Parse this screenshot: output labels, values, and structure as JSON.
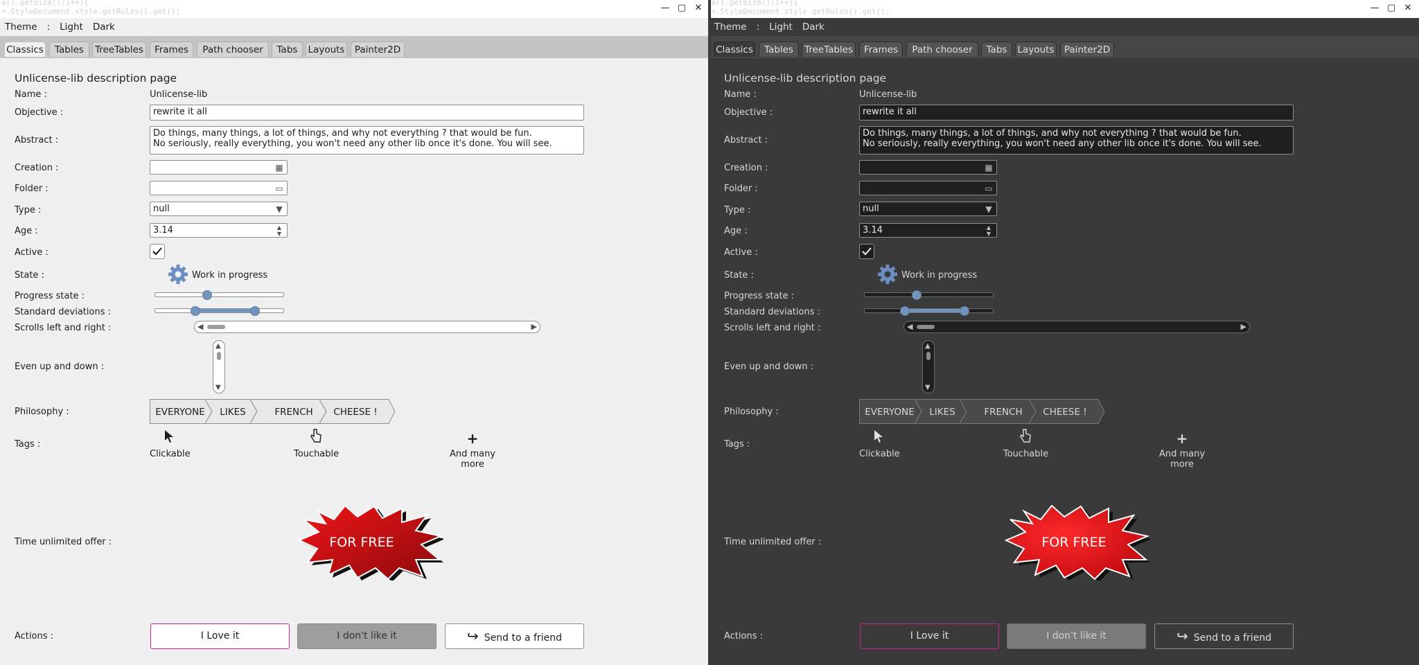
{
  "window": {
    "bg_code": "a().getSize();i++){\n=.StyleDocument.style.getRules().get();",
    "minimize_glyph": "—",
    "maximize_glyph": "▢",
    "close_glyph": "✕"
  },
  "menu": {
    "theme": "Theme",
    "sep": ":",
    "light": "Light",
    "dark": "Dark"
  },
  "tabs": [
    "Classics",
    "Tables",
    "TreeTables",
    "Frames",
    "Path chooser",
    "Tabs",
    "Layouts",
    "Painter2D"
  ],
  "page": {
    "title": "Unlicense-lib description page",
    "labels": {
      "name": "Name :",
      "objective": "Objective :",
      "abstract": "Abstract :",
      "creation": "Creation :",
      "folder": "Folder :",
      "type": "Type :",
      "age": "Age :",
      "active": "Active :",
      "state": "State :",
      "progress": "Progress state :",
      "stddev": "Standard deviations :",
      "scrolls": "Scrolls left and right :",
      "updown": "Even up and down :",
      "philosophy": "Philosophy :",
      "tags": "Tags :",
      "offer": "Time unlimited offer :",
      "actions": "Actions :"
    },
    "name_value": "Unlicense-lib",
    "objective_value": "rewrite it all",
    "abstract_line1": "Do things, many things, a lot of things, and why not everything ? that would be fun.",
    "abstract_line2": "No seriously, really everything, you won't need any other lib once it's done. You will see.",
    "creation_value": "",
    "folder_value": "",
    "type_value": "null",
    "age_value": "3.14",
    "active_checked": true,
    "state_text": "Work in progress",
    "progress_value": 0.4,
    "stddev_low": 0.3,
    "stddev_high": 0.8,
    "hscroll_value": 0.0,
    "vscroll_value": 0.0,
    "philosophy": [
      "EVERYONE",
      "LIKES",
      "FRENCH",
      "CHEESE !"
    ],
    "tags": [
      {
        "icon": "arrow-cursor-icon",
        "label": "Clickable"
      },
      {
        "icon": "hand-cursor-icon",
        "label": "Touchable"
      },
      {
        "icon": "plus-icon",
        "label": "And many more"
      }
    ],
    "offer_text": "FOR FREE",
    "actions": {
      "love": "I Love it",
      "dislike": "I don't like it",
      "send": "Send to a friend"
    }
  },
  "colors": {
    "accent_slider": "#7394bd",
    "love_border": "#c0288a",
    "starburst_red": "#d8121a"
  }
}
